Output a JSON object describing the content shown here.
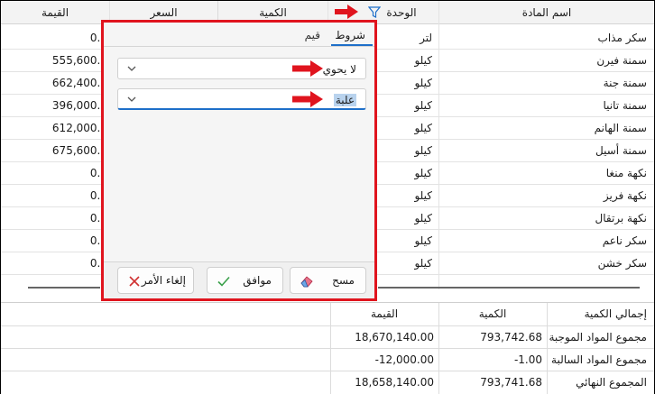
{
  "grid": {
    "columns": [
      "اسم المادة",
      "الوحدة",
      "الكمية",
      "السعر",
      "القيمة"
    ],
    "rows": [
      {
        "name": "سكر مذاب",
        "unit": "لتر",
        "value": "0.0"
      },
      {
        "name": "سمنة فيرن",
        "unit": "كيلو",
        "value": "555,600.0"
      },
      {
        "name": "سمنة جنة",
        "unit": "كيلو",
        "value": "662,400.0"
      },
      {
        "name": "سمنة تانيا",
        "unit": "كيلو",
        "value": "396,000.0"
      },
      {
        "name": "سمنة الهانم",
        "unit": "كيلو",
        "value": "612,000.0"
      },
      {
        "name": "سمنة أسيل",
        "unit": "كيلو",
        "value": "675,600.0"
      },
      {
        "name": "نكهة منغا",
        "unit": "كيلو",
        "value": "0.0"
      },
      {
        "name": "نكهة فريز",
        "unit": "كيلو",
        "value": "0.0"
      },
      {
        "name": "نكهة برتقال",
        "unit": "كيلو",
        "value": "0.0"
      },
      {
        "name": "سكر ناعم",
        "unit": "كيلو",
        "value": "0.0"
      },
      {
        "name": "سكر خشن",
        "unit": "كيلو",
        "value": "0.0"
      }
    ]
  },
  "filter": {
    "tabs": [
      "شروط",
      "قيم"
    ],
    "operator": "لا يحوي",
    "value": "علبة",
    "buttons": {
      "clear": "مسح",
      "ok": "موافق",
      "cancel": "إلغاء الأمر"
    }
  },
  "summary": {
    "headers": [
      "إجمالي الكمية",
      "الكمية",
      "القيمة"
    ],
    "rows": [
      {
        "label": "مجموع المواد الموجبة",
        "qty": "793,742.68",
        "value": "18,670,140.00"
      },
      {
        "label": "مجموع المواد السالبة",
        "qty": "-1.00",
        "value": "-12,000.00"
      },
      {
        "label": "المجموع النهائي",
        "qty": "793,741.68",
        "value": "18,658,140.00"
      }
    ]
  },
  "colors": {
    "highlight_border": "#e0141e",
    "accent": "#1e6fc9",
    "arrow": "#e0141e"
  }
}
